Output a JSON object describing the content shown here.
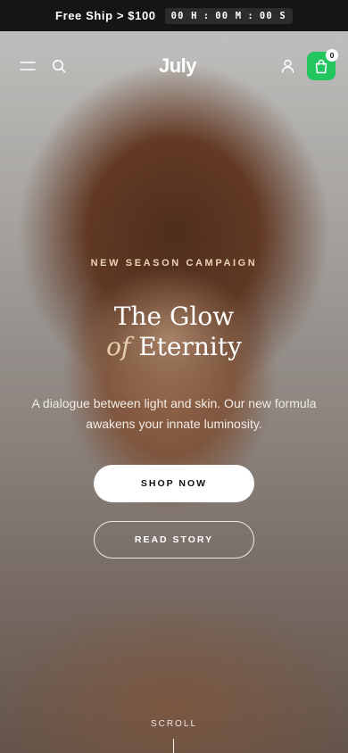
{
  "topbar": {
    "promo": "Free Ship > $100",
    "timer": {
      "hours": "00 H",
      "minutes": "00 M",
      "seconds": "00 S",
      "sep1": ":",
      "sep2": ":"
    }
  },
  "header": {
    "logo": "July",
    "cart_count": "0",
    "icons": [
      "menu-icon",
      "search-icon",
      "user-icon",
      "shopping-bag-icon"
    ],
    "cart_color": "#22c55e"
  },
  "hero": {
    "eyebrow": "NEW SEASON CAMPAIGN",
    "title_line1": "The Glow",
    "title_of": "of",
    "title_line2": "Eternity",
    "subtitle": "A dialogue between light and skin. Our new formula awakens your innate luminosity.",
    "primary_button": "SHOP NOW",
    "secondary_button": "READ STORY",
    "scroll_label": "SCROLL",
    "accent_color": "#e9d3b5"
  }
}
